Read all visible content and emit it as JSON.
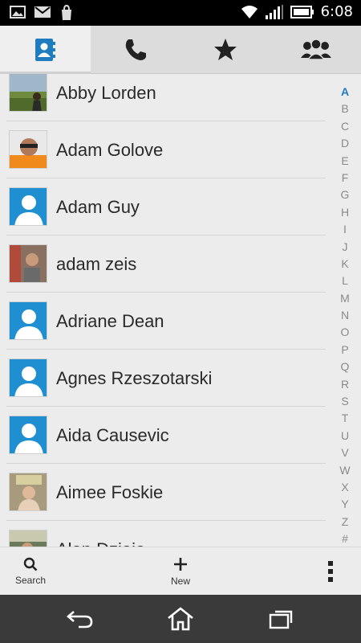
{
  "status_bar": {
    "time": "6:08",
    "icons": [
      "gallery-icon",
      "gmail-icon",
      "store-icon",
      "wifi-icon",
      "signal-icon",
      "battery-icon"
    ]
  },
  "tabs": [
    {
      "name": "contacts",
      "icon": "contacts-book-icon",
      "active": true
    },
    {
      "name": "phone",
      "icon": "phone-icon",
      "active": false
    },
    {
      "name": "favorites",
      "icon": "star-icon",
      "active": false
    },
    {
      "name": "groups",
      "icon": "groups-icon",
      "active": false
    }
  ],
  "contacts": [
    {
      "name": "Abby Lorden",
      "avatar": "photo-landscape"
    },
    {
      "name": "Adam Golove",
      "avatar": "photo-orange"
    },
    {
      "name": "Adam Guy",
      "avatar": "default"
    },
    {
      "name": "adam zeis",
      "avatar": "photo-street"
    },
    {
      "name": "Adriane Dean",
      "avatar": "default"
    },
    {
      "name": "Agnes Rzeszotarski",
      "avatar": "default"
    },
    {
      "name": "Aida Causevic",
      "avatar": "default"
    },
    {
      "name": "Aimee Foskie",
      "avatar": "photo-person"
    },
    {
      "name": "Alan Dziaia",
      "avatar": "photo-outdoor"
    }
  ],
  "index_letters": [
    "A",
    "B",
    "C",
    "D",
    "E",
    "F",
    "G",
    "H",
    "I",
    "J",
    "K",
    "L",
    "M",
    "N",
    "O",
    "P",
    "Q",
    "R",
    "S",
    "T",
    "U",
    "V",
    "W",
    "X",
    "Y",
    "Z",
    "#"
  ],
  "index_active": "A",
  "actions": {
    "search_label": "Search",
    "new_label": "New"
  },
  "colors": {
    "accent": "#1f7dbf",
    "avatar_default_bg": "#1f8fd1"
  }
}
